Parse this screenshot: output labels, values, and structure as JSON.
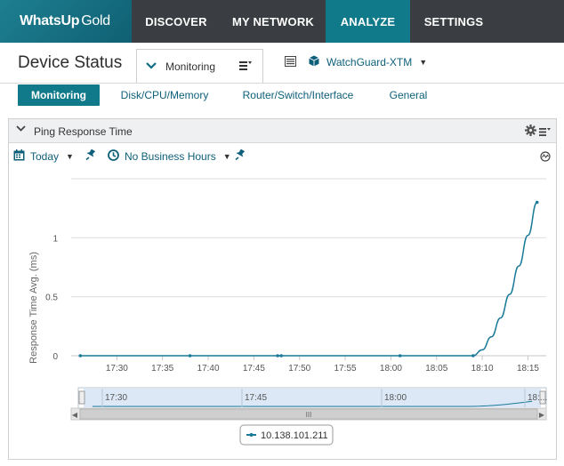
{
  "nav": {
    "logo_main": "WhatsUp",
    "logo_accent": "Gold",
    "items": [
      {
        "label": "DISCOVER"
      },
      {
        "label": "MY NETWORK"
      },
      {
        "label": "ANALYZE"
      },
      {
        "label": "SETTINGS"
      }
    ]
  },
  "header": {
    "title": "Device Status",
    "dashboard_select": "Monitoring",
    "device": "WatchGuard-XTM"
  },
  "tabs": [
    {
      "label": "Monitoring"
    },
    {
      "label": "Disk/CPU/Memory"
    },
    {
      "label": "Router/Switch/Interface"
    },
    {
      "label": "General"
    }
  ],
  "panel": {
    "title": "Ping Response Time",
    "range": "Today",
    "business_hours": "No Business Hours"
  },
  "colors": {
    "accent": "#107a8b",
    "nav_bg": "#3a3d41",
    "series": "#1a7a99"
  },
  "chart_data": {
    "type": "line",
    "title": "Ping Response Time",
    "xlabel": "",
    "ylabel": "Response Time Avg. (ms)",
    "ylim": [
      0,
      1.5
    ],
    "y_ticks": [
      "0",
      "0.5",
      "1"
    ],
    "x_ticks": [
      "17:30",
      "17:35",
      "17:40",
      "17:45",
      "17:50",
      "17:55",
      "18:00",
      "18:05",
      "18:10",
      "18:15"
    ],
    "navigator_ticks": [
      "17:30",
      "17:45",
      "18:00",
      "18:..."
    ],
    "series": [
      {
        "name": "10.138.101.211",
        "x": [
          "17:26",
          "17:38",
          "17:48",
          "18:01",
          "18:09",
          "18:10",
          "18:11",
          "18:12",
          "18:13",
          "18:14",
          "18:15",
          "18:16"
        ],
        "values": [
          0,
          0,
          0,
          0,
          0,
          0.05,
          0.16,
          0.32,
          0.52,
          0.76,
          1.02,
          1.3
        ]
      }
    ],
    "legend": "bottom-center"
  }
}
